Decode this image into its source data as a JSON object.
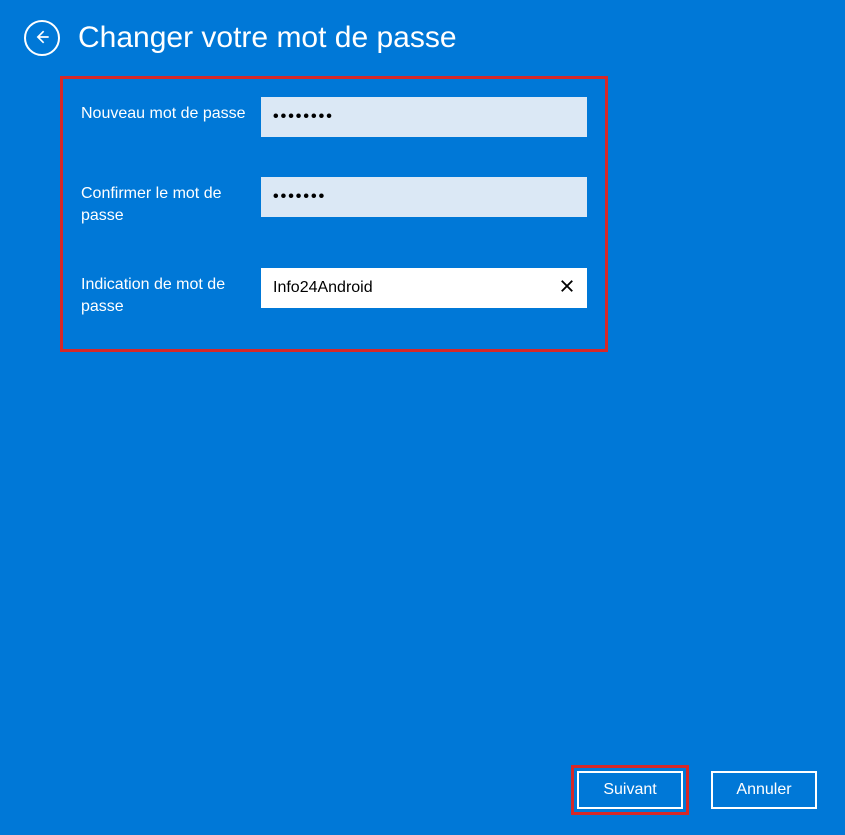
{
  "header": {
    "title": "Changer votre mot de passe"
  },
  "form": {
    "new_password": {
      "label": "Nouveau mot de passe",
      "value": "••••••••"
    },
    "confirm_password": {
      "label": "Confirmer le mot de passe",
      "value": "•••••••"
    },
    "hint": {
      "label": "Indication de mot de passe",
      "value": "Info24Android"
    }
  },
  "footer": {
    "next_label": "Suivant",
    "cancel_label": "Annuler"
  }
}
